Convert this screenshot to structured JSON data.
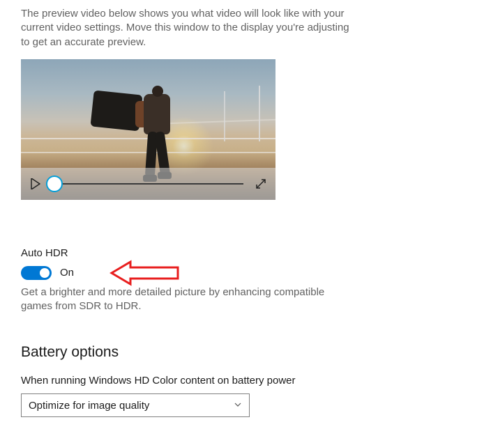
{
  "preview": {
    "helper_text": "The preview video below shows you what video will look like with your current video settings. Move this window to the display you're adjusting to get an accurate preview."
  },
  "auto_hdr": {
    "label": "Auto HDR",
    "state_text": "On",
    "enabled": true,
    "description": "Get a brighter and more detailed picture by enhancing compatible games from SDR to HDR."
  },
  "battery": {
    "heading": "Battery options",
    "sublabel": "When running Windows HD Color content on battery power",
    "selected_option": "Optimize for image quality"
  },
  "colors": {
    "accent": "#0078d4",
    "annotation": "#e81e1e"
  }
}
